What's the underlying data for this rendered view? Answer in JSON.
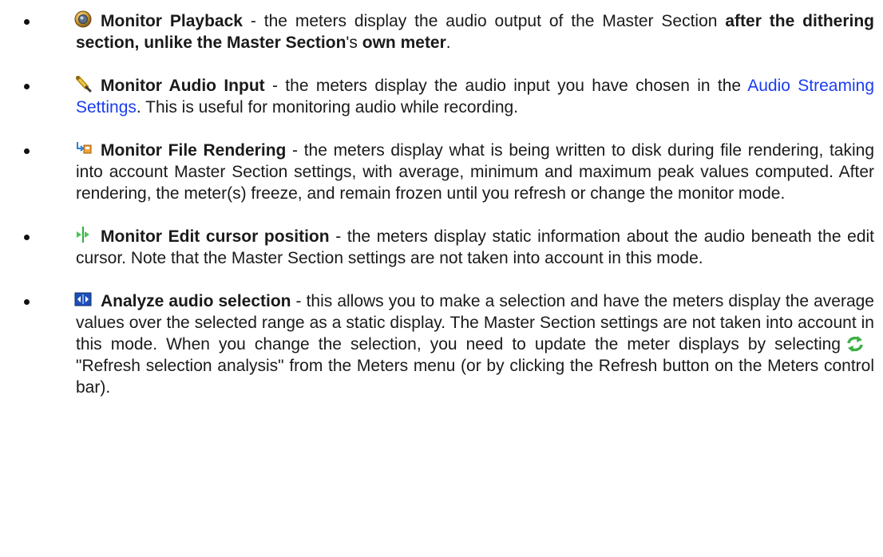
{
  "items": [
    {
      "icon": "speaker-icon",
      "title": "Monitor Playback",
      "text_a": " - the meters display the audio output of the Master Section ",
      "bold_a": "after the dithering section, unlike the Master Section",
      "text_b": "'s ",
      "bold_b": "own meter",
      "text_c": "."
    },
    {
      "icon": "probe-icon",
      "title": "Monitor Audio Input",
      "text_a": " - the meters display the audio input you have chosen in the ",
      "link": "Audio Streaming Settings",
      "text_b": ". This is useful for monitoring audio while recording."
    },
    {
      "icon": "file-render-icon",
      "title": "Monitor File Rendering",
      "text_a": " - the meters display what is being written to disk during file rendering, taking into account Master Section settings, with average, minimum and maximum peak values computed.  After rendering, the meter(s) freeze, and remain frozen until you refresh or change the monitor mode."
    },
    {
      "icon": "edit-cursor-icon",
      "title": "Monitor Edit cursor position",
      "text_a": " - the meters display static information about the audio beneath the edit cursor. Note that the Master Section settings are not taken into account in this mode."
    },
    {
      "icon": "analyze-selection-icon",
      "title": "Analyze audio selection",
      "text_a": " - this allows you to make a selection and have the meters display the average values over the selected range as a static display.  The Master Section settings are not taken into account in this mode. When you change the selection, you need to update the meter displays by selecting",
      "inline_icon": "refresh-icon",
      "text_b": "\"Refresh selection analysis\" from the Meters menu (or by clicking the Refresh button on the Meters control bar)."
    }
  ],
  "colors": {
    "link": "#1a3cf0",
    "text": "#1a1a1a",
    "refresh_icon": "#3cb043"
  }
}
